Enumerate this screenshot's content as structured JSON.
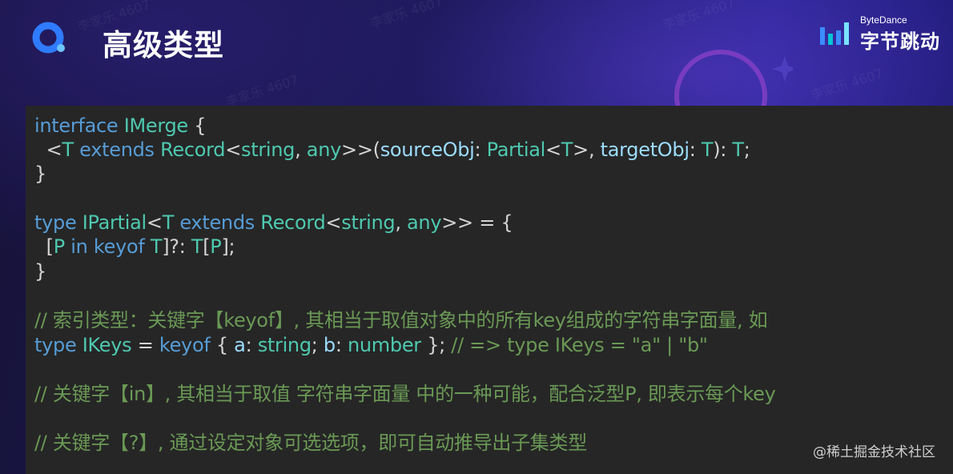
{
  "header": {
    "title": "高级类型",
    "brand_en": "ByteDance",
    "brand_cn": "字节跳动",
    "accent": "#2f7bff"
  },
  "watermark_text": "李家乐 4607",
  "code": {
    "lines": [
      [
        {
          "t": "interface",
          "c": "kw"
        },
        {
          "t": " ",
          "c": "pl"
        },
        {
          "t": "IMerge",
          "c": "ty"
        },
        {
          "t": " {",
          "c": "pl"
        }
      ],
      [
        {
          "t": "  <",
          "c": "pl"
        },
        {
          "t": "T",
          "c": "ty"
        },
        {
          "t": " extends ",
          "c": "kw"
        },
        {
          "t": "Record",
          "c": "ty"
        },
        {
          "t": "<",
          "c": "pl"
        },
        {
          "t": "string",
          "c": "ty"
        },
        {
          "t": ", ",
          "c": "pl"
        },
        {
          "t": "any",
          "c": "ty"
        },
        {
          "t": ">>(",
          "c": "pl"
        },
        {
          "t": "sourceObj",
          "c": "va"
        },
        {
          "t": ": ",
          "c": "pl"
        },
        {
          "t": "Partial",
          "c": "ty"
        },
        {
          "t": "<",
          "c": "pl"
        },
        {
          "t": "T",
          "c": "ty"
        },
        {
          "t": ">, ",
          "c": "pl"
        },
        {
          "t": "targetObj",
          "c": "va"
        },
        {
          "t": ": ",
          "c": "pl"
        },
        {
          "t": "T",
          "c": "ty"
        },
        {
          "t": "): ",
          "c": "pl"
        },
        {
          "t": "T",
          "c": "ty"
        },
        {
          "t": ";",
          "c": "pl"
        }
      ],
      [
        {
          "t": "}",
          "c": "pl"
        }
      ],
      [],
      [
        {
          "t": "type",
          "c": "kw"
        },
        {
          "t": " ",
          "c": "pl"
        },
        {
          "t": "IPartial",
          "c": "ty"
        },
        {
          "t": "<",
          "c": "pl"
        },
        {
          "t": "T",
          "c": "ty"
        },
        {
          "t": " extends ",
          "c": "kw"
        },
        {
          "t": "Record",
          "c": "ty"
        },
        {
          "t": "<",
          "c": "pl"
        },
        {
          "t": "string",
          "c": "ty"
        },
        {
          "t": ", ",
          "c": "pl"
        },
        {
          "t": "any",
          "c": "ty"
        },
        {
          "t": ">> = {",
          "c": "pl"
        }
      ],
      [
        {
          "t": "  [",
          "c": "pl"
        },
        {
          "t": "P",
          "c": "ty"
        },
        {
          "t": " in keyof ",
          "c": "kw"
        },
        {
          "t": "T",
          "c": "ty"
        },
        {
          "t": "]?: ",
          "c": "pl"
        },
        {
          "t": "T",
          "c": "ty"
        },
        {
          "t": "[",
          "c": "pl"
        },
        {
          "t": "P",
          "c": "ty"
        },
        {
          "t": "];",
          "c": "pl"
        }
      ],
      [
        {
          "t": "}",
          "c": "pl"
        }
      ],
      [],
      [
        {
          "t": "// 索引类型：关键字【keyof】, 其相当于取值对象中的所有key组成的字符串字面量, 如",
          "c": "cm"
        }
      ],
      [
        {
          "t": "type",
          "c": "kw"
        },
        {
          "t": " ",
          "c": "pl"
        },
        {
          "t": "IKeys",
          "c": "ty"
        },
        {
          "t": " = ",
          "c": "pl"
        },
        {
          "t": "keyof",
          "c": "kw"
        },
        {
          "t": " { ",
          "c": "pl"
        },
        {
          "t": "a",
          "c": "va"
        },
        {
          "t": ": ",
          "c": "pl"
        },
        {
          "t": "string",
          "c": "ty"
        },
        {
          "t": "; ",
          "c": "pl"
        },
        {
          "t": "b",
          "c": "va"
        },
        {
          "t": ": ",
          "c": "pl"
        },
        {
          "t": "number",
          "c": "ty"
        },
        {
          "t": " }; ",
          "c": "pl"
        },
        {
          "t": "// => type IKeys = \"a\" | \"b\"",
          "c": "cm"
        }
      ],
      [],
      [
        {
          "t": "// 关键字【in】, 其相当于取值 字符串字面量 中的一种可能，配合泛型P, 即表示每个key",
          "c": "cm"
        }
      ],
      [],
      [
        {
          "t": "// 关键字【?】, 通过设定对象可选选项，即可自动推导出子集类型",
          "c": "cm"
        }
      ]
    ]
  },
  "credit": "@稀土掘金技术社区"
}
